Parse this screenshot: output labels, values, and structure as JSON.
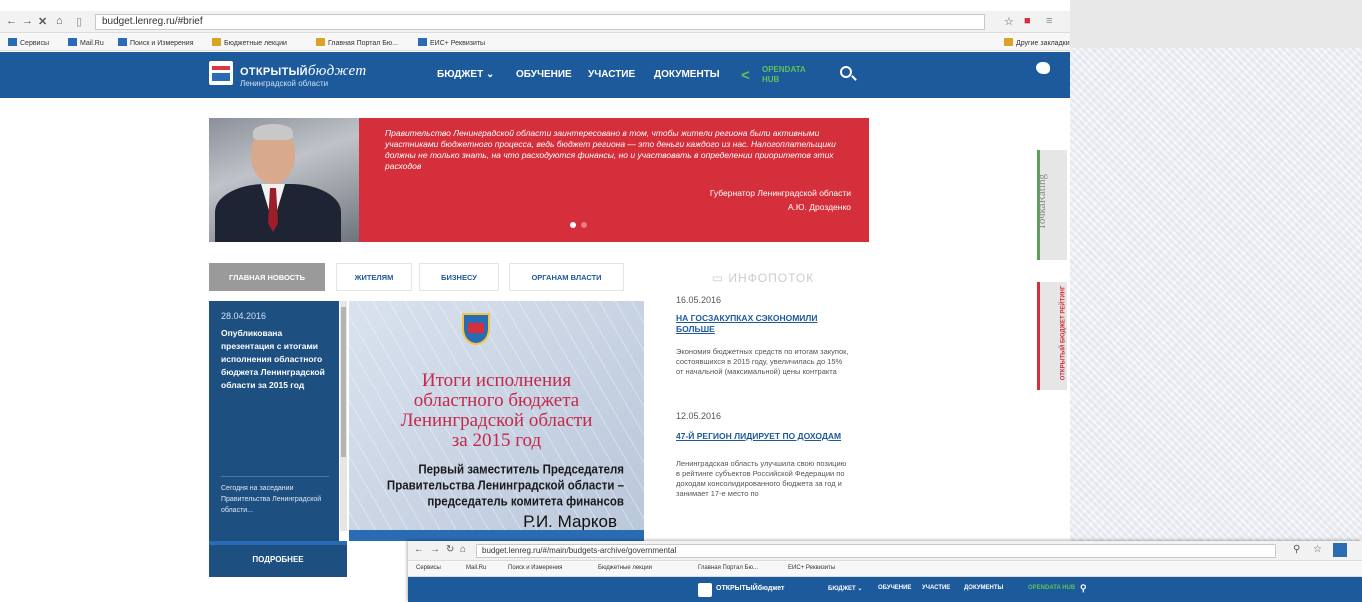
{
  "browser": {
    "url": "budget.lenreg.ru/#brief",
    "bookmarks": [
      {
        "label": "Сервисы",
        "color": "#2a6cb3"
      },
      {
        "label": "Mail.Ru",
        "color": "#2a6cb3"
      },
      {
        "label": "Поиск и Измерения",
        "color": "#2a6cb3"
      },
      {
        "label": "Бюджетные лекции",
        "color": "#d9a325"
      },
      {
        "label": "Главная Портал Бю...",
        "color": "#d9a325"
      },
      {
        "label": "ЕИС+ Реквизиты",
        "color": "#2a6cb3"
      }
    ],
    "bookmarks_right": "Другие закладки"
  },
  "site": {
    "logo_prefix": "ОТКРЫТЫЙ",
    "logo_script": "бюджет",
    "logo_sub": "Ленинградской области",
    "menu": [
      "БЮДЖЕТ ⌄",
      "ОБУЧЕНИЕ",
      "УЧАСТИЕ",
      "ДОКУМЕНТЫ"
    ],
    "opendata": "OPENDATA HUB",
    "accent": "#1d5a9c"
  },
  "hero": {
    "quote": "Правительство Ленинградской области заинтересовано в том, чтобы жители региона были активными участниками бюджетного процесса, ведь бюджет региона — это деньги каждого из нас. Налогоплательщики должны не только знать, на что расходуются финансы, но и участвовать в определении приоритетов этих расходов",
    "signature_role": "Губернатор Ленинградской области",
    "signature_name": "А.Ю. Дрозденко",
    "color": "#d42f3a"
  },
  "tabs": [
    "ГЛАВНАЯ НОВОСТЬ",
    "ЖИТЕЛЯМ",
    "БИЗНЕСУ",
    "ОРГАНАМ ВЛАСТИ"
  ],
  "main_news": {
    "date": "28.04.2016",
    "title": "Опубликована презентация с итогами исполнения областного бюджета Ленинградской области за 2015 год",
    "excerpt": "Сегодня на заседании Правительства Ленинградской области...",
    "more_button": "ПОДРОБНЕЕ"
  },
  "slide": {
    "title": "Итоги исполнения областного бюджета Ленинградской области за 2015 год",
    "title_lines": [
      "Итоги исполнения",
      "областного  бюджета",
      "Ленинградской области",
      "за 2015 год"
    ],
    "position_lines": [
      "Первый заместитель Председателя",
      "Правительства Ленинградской области –",
      "председатель комитета финансов"
    ],
    "name": "Р.И. Марков"
  },
  "infopotok": {
    "heading": "ИНФОПОТОК",
    "items": [
      {
        "date": "16.05.2016",
        "title": "НА ГОСЗАКУПКАХ СЭКОНОМИЛИ БОЛЬШЕ",
        "text": "Экономия бюджетных средств по итогам закупок, состоявшихся в 2015 году, увеличилась до 15% от начальной (максимальной) цены контракта"
      },
      {
        "date": "12.05.2016",
        "title": "47-Й РЕГИОН ЛИДИРУЕТ ПО ДОХОДАМ",
        "text": "Ленинградская область улучшила свою позицию в рейтинге субъектов Российской Федерации по доходам консолидированного бюджета за год и занимает 17-е место по"
      }
    ]
  },
  "side_widgets": {
    "feedback": "ТочкаRating",
    "rating": "ОТКРЫТЫЙ БЮДЖЕТ РЕЙТИНГ"
  },
  "second_window": {
    "url": "budget.lenreg.ru/#/main/budgets-archive/governmental",
    "menu": [
      "БЮДЖЕТ ⌄",
      "ОБУЧЕНИЕ",
      "УЧАСТИЕ",
      "ДОКУМЕНТЫ"
    ]
  }
}
